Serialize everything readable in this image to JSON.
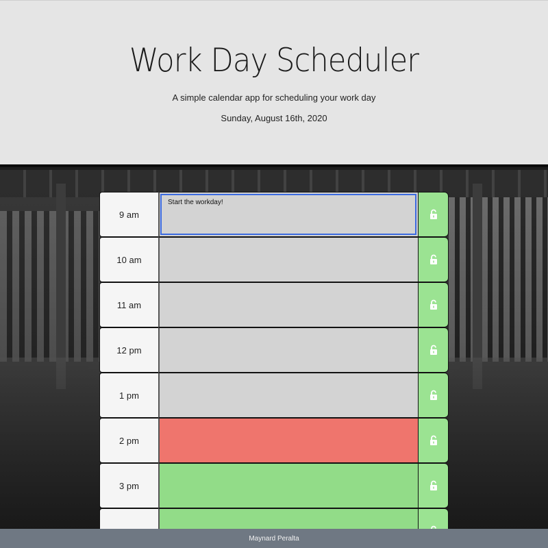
{
  "header": {
    "title": "Work Day Scheduler",
    "lead": "A simple calendar app for scheduling your work day",
    "current_day": "Sunday, August 16th, 2020"
  },
  "colors": {
    "past": "#d3d3d3",
    "present": "#ef756d",
    "future": "#92dc88",
    "save": "#9be392"
  },
  "save_icon": "unlock-icon",
  "rows": [
    {
      "hour": "9 am",
      "text": "Start the workday!",
      "state": "past"
    },
    {
      "hour": "10 am",
      "text": "",
      "state": "past"
    },
    {
      "hour": "11 am",
      "text": "",
      "state": "past"
    },
    {
      "hour": "12 pm",
      "text": "",
      "state": "past"
    },
    {
      "hour": "1 pm",
      "text": "",
      "state": "past"
    },
    {
      "hour": "2 pm",
      "text": "",
      "state": "present"
    },
    {
      "hour": "3 pm",
      "text": "",
      "state": "future"
    },
    {
      "hour": "",
      "text": "",
      "state": "future"
    }
  ],
  "footer": {
    "author": "Maynard Peralta"
  }
}
